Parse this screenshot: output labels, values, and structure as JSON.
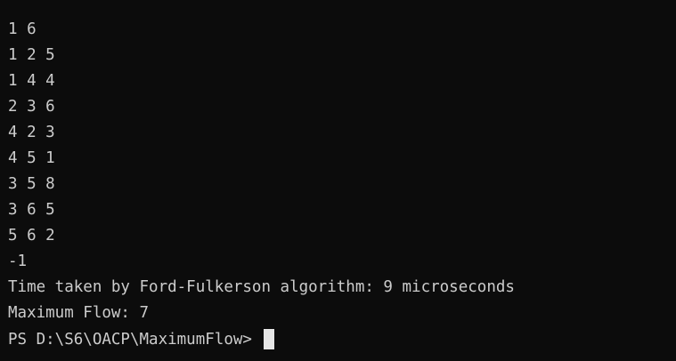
{
  "terminal": {
    "lines": [
      "1 6",
      "1 2 5",
      "1 4 4",
      "2 3 6",
      "4 2 3",
      "4 5 1",
      "3 5 8",
      "3 6 5",
      "5 6 2",
      "-1",
      "Time taken by Ford-Fulkerson algorithm: 9 microseconds",
      "Maximum Flow: 7"
    ],
    "prompt": "PS D:\\S6\\OACP\\MaximumFlow> "
  },
  "colors": {
    "background": "#0c0c0c",
    "text": "#cccccc",
    "cursor": "#e6e6e6"
  }
}
